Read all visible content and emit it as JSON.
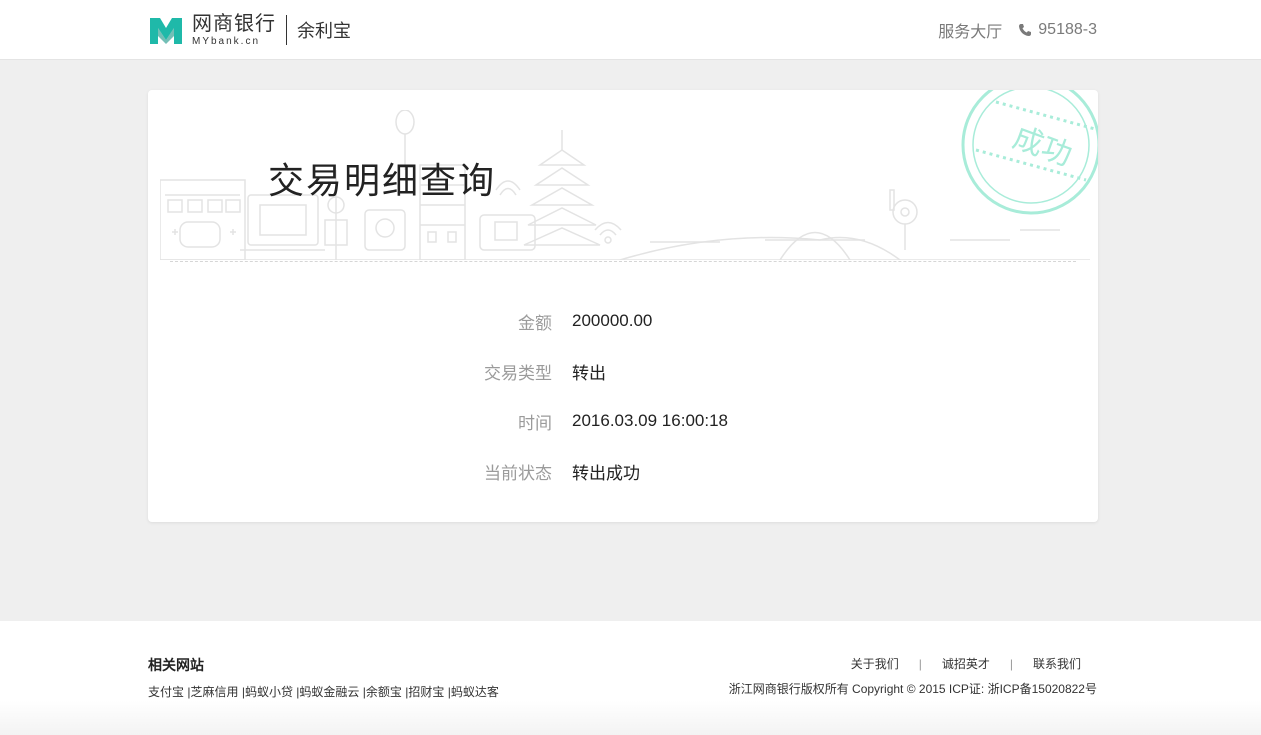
{
  "header": {
    "brand_cn": "网商银行",
    "brand_en": "MYbank.cn",
    "product": "余利宝",
    "service_hall": "服务大厅",
    "phone": "95188-3"
  },
  "card": {
    "title": "交易明细查询",
    "stamp_text": "成功",
    "rows": [
      {
        "label": "金额",
        "value": "200000.00"
      },
      {
        "label": "交易类型",
        "value": "转出"
      },
      {
        "label": "时间",
        "value": "2016.03.09 16:00:18"
      },
      {
        "label": "当前状态",
        "value": "转出成功"
      }
    ]
  },
  "footer": {
    "heading": "相关网站",
    "links": [
      "支付宝",
      "|芝麻信用",
      "|蚂蚁小贷",
      "|蚂蚁金融云",
      "|余额宝",
      "|招财宝",
      "|蚂蚁达客"
    ],
    "nav": [
      "关于我们",
      "诚招英才",
      "联系我们"
    ],
    "nav_separator": "|",
    "copyright": "浙江网商银行版权所有 Copyright © 2015 ICP证: 浙ICP备15020822号"
  },
  "colors": {
    "logo_teal": "#1fb9a9",
    "stamp_mint": "#a8ecd9"
  },
  "icons": {
    "logo": "mybank-logo-icon",
    "phone": "phone-icon",
    "stamp": "success-stamp-icon"
  }
}
